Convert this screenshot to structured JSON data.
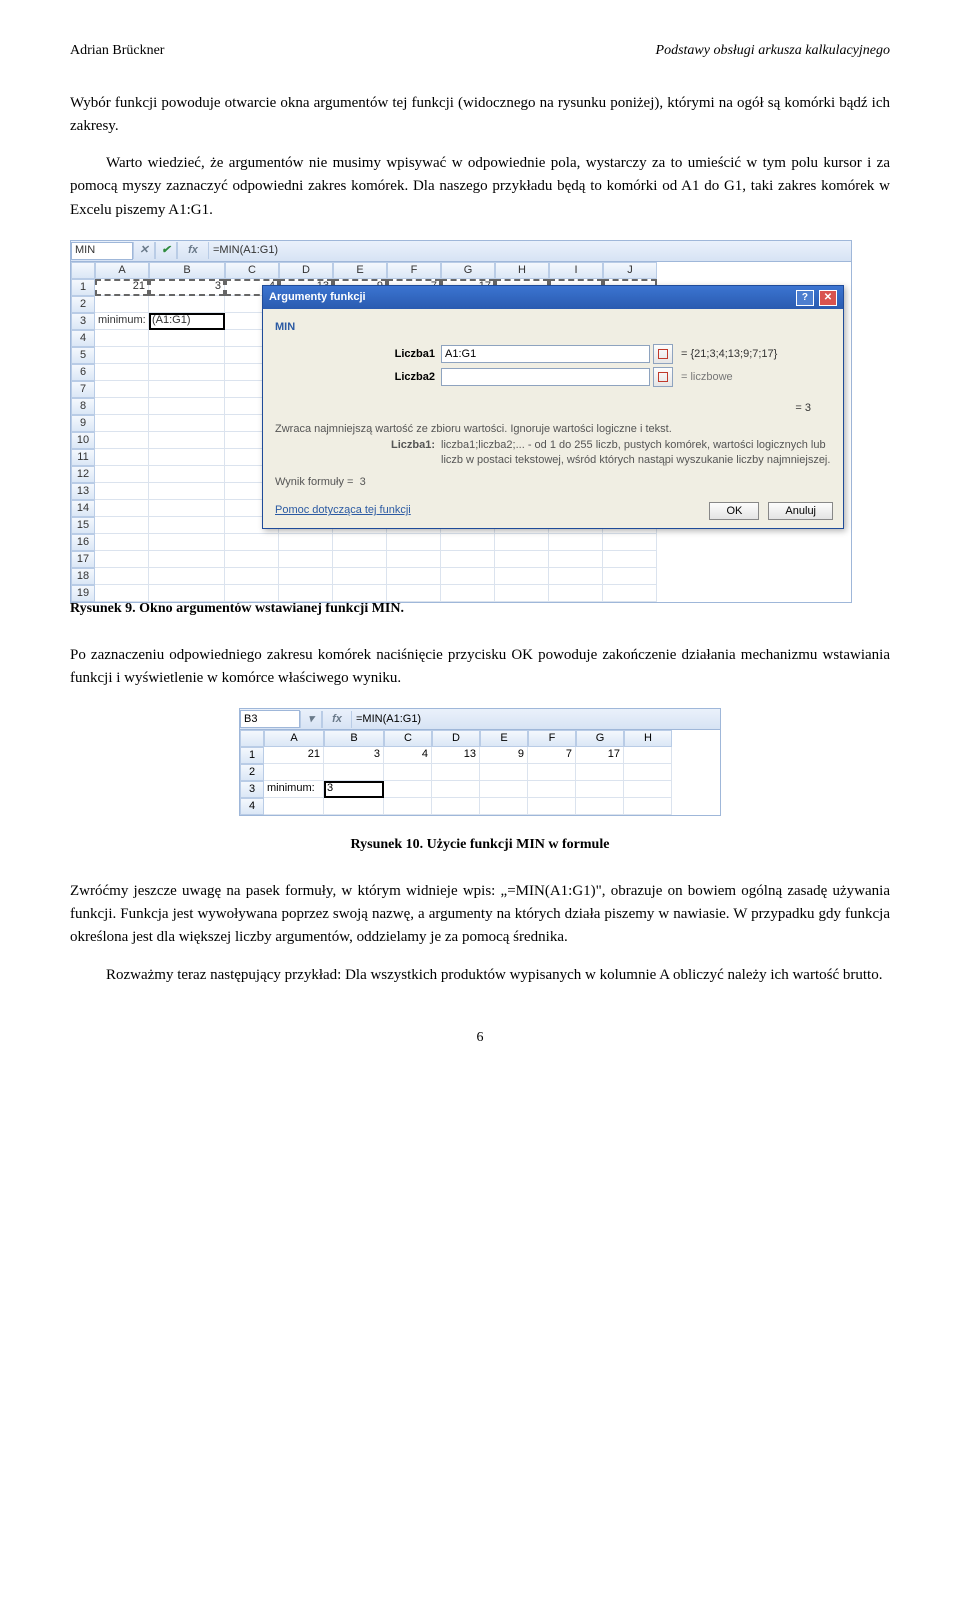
{
  "header": {
    "author": "Adrian Brückner",
    "title": "Podstawy obsługi arkusza kalkulacyjnego"
  },
  "p1": "Wybór funkcji powoduje otwarcie okna argumentów tej funkcji (widocznego na rysunku poniżej), którymi na ogół są komórki bądź ich zakresy.",
  "p2": "Warto wiedzieć, że argumentów nie musimy wpisywać w odpowiednie pola, wystarczy za to umieścić w tym polu kursor i za pomocą myszy zaznaczyć odpowiedni zakres komórek. Dla naszego przykładu będą to komórki od A1 do G1, taki zakres komórek w Excelu piszemy A1:G1.",
  "p3": "Po zaznaczeniu odpowiedniego zakresu komórek naciśnięcie przycisku OK powoduje zakończenie działania mechanizmu wstawiania funkcji i wyświetlenie w komórce właściwego wyniku.",
  "p4": "Zwróćmy jeszcze uwagę na pasek formuły, w którym widnieje wpis: „=MIN(A1:G1)\", obrazuje on bowiem ogólną zasadę używania funkcji. Funkcja jest wywoływana poprzez swoją nazwę, a argumenty na których działa piszemy w nawiasie. W przypadku gdy funkcja określona jest dla większej liczby argumentów, oddzielamy je za pomocą średnika.",
  "p5": "Rozważmy teraz następujący przykład: Dla wszystkich produktów wypisanych w kolumnie A obliczyć należy ich wartość brutto.",
  "captions": {
    "fig9": "Rysunek 9. Okno argumentów wstawianej funkcji MIN.",
    "fig10": "Rysunek 10. Użycie funkcji MIN w formule"
  },
  "fig9": {
    "namebox": "MIN",
    "fxIcons": {
      "cancel": "✕",
      "confirm": "✔",
      "fx": "fx"
    },
    "formula": "=MIN(A1:G1)",
    "cols": [
      "A",
      "B",
      "C",
      "D",
      "E",
      "F",
      "G",
      "H",
      "I",
      "J"
    ],
    "rows": [
      "1",
      "2",
      "3",
      "4",
      "5",
      "6",
      "7",
      "8",
      "9",
      "10",
      "11",
      "12",
      "13",
      "14",
      "15",
      "16",
      "17",
      "18",
      "19"
    ],
    "row1": [
      "21",
      "3",
      "4",
      "13",
      "9",
      "7",
      "17",
      "",
      "",
      ""
    ],
    "a3lbl": "minimum:",
    "b3val": "(A1:G1)",
    "dialog": {
      "title": "Argumenty funkcji",
      "helpBtn": "?",
      "closeBtn": "✕",
      "fn": "MIN",
      "arg1name": "Liczba1",
      "arg1val": "A1:G1",
      "arg1res": "= {21;3;4;13;9;7;17}",
      "arg2name": "Liczba2",
      "arg2val": "",
      "arg2res": "= liczbowe",
      "eqres": "= 3",
      "desc1": "Zwraca najmniejszą wartość ze zbioru wartości. Ignoruje wartości logiczne i tekst.",
      "argdescLbl": "Liczba1:",
      "argdescTxt": "liczba1;liczba2;... - od 1 do 255 liczb, pustych komórek, wartości logicznych lub liczb w postaci tekstowej, wśród których nastąpi wyszukanie liczby najmniejszej.",
      "resLbl": "Wynik formuły =",
      "resVal": "3",
      "helpLink": "Pomoc dotycząca tej funkcji",
      "ok": "OK",
      "cancel": "Anuluj"
    }
  },
  "fig10": {
    "namebox": "B3",
    "fx": "fx",
    "formula": "=MIN(A1:G1)",
    "cols": [
      "A",
      "B",
      "C",
      "D",
      "E",
      "F",
      "G",
      "H"
    ],
    "rows": [
      "1",
      "2",
      "3",
      "4"
    ],
    "row1": [
      "21",
      "3",
      "4",
      "13",
      "9",
      "7",
      "17",
      ""
    ],
    "a3": "minimum:",
    "b3": "3"
  },
  "page": "6"
}
